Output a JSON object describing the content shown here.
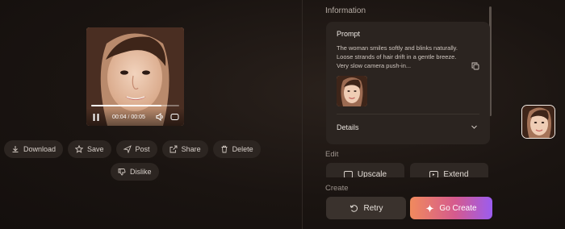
{
  "player": {
    "current_time": "00:04",
    "separator": "/",
    "duration": "00:05",
    "progress": 0.8
  },
  "actions": [
    {
      "label": "Download",
      "icon": "download-icon"
    },
    {
      "label": "Save",
      "icon": "star-icon"
    },
    {
      "label": "Post",
      "icon": "send-icon"
    },
    {
      "label": "Share",
      "icon": "share-icon"
    },
    {
      "label": "Delete",
      "icon": "trash-icon"
    },
    {
      "label": "Dislike",
      "icon": "thumbs-down-icon"
    }
  ],
  "info": {
    "heading": "Information",
    "prompt_title": "Prompt",
    "prompt_text": "The woman smiles softly and blinks naturally. Loose strands of hair drift in a gentle breeze. Very slow camera push-in...",
    "details_label": "Details"
  },
  "edit": {
    "heading": "Edit",
    "upscale_label": "Upscale",
    "extend_label": "Extend"
  },
  "create": {
    "heading": "Create",
    "retry_label": "Retry",
    "go_label": "Go Create"
  },
  "colors": {
    "accent_gradient_start": "#f08a5d",
    "accent_gradient_mid": "#d55a8e",
    "accent_gradient_end": "#9b5cf0"
  }
}
